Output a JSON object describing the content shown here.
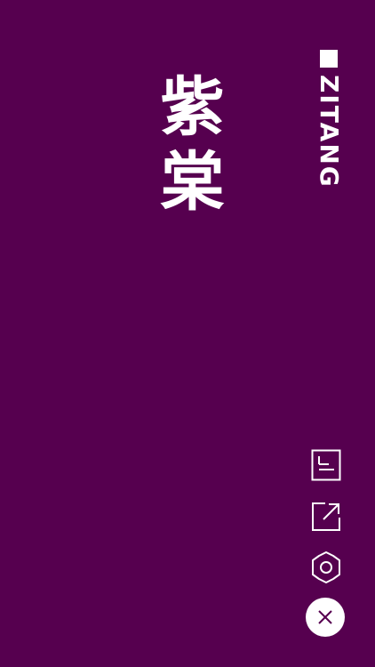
{
  "theme": {
    "background": "#56004f",
    "foreground": "#ffffff"
  },
  "color": {
    "chinese_name": "紫棠",
    "romanization": "ZITANG"
  },
  "toolbar": {
    "items": [
      {
        "icon": "document-icon"
      },
      {
        "icon": "share-icon"
      },
      {
        "icon": "settings-gear-icon"
      },
      {
        "icon": "close-icon"
      }
    ]
  }
}
